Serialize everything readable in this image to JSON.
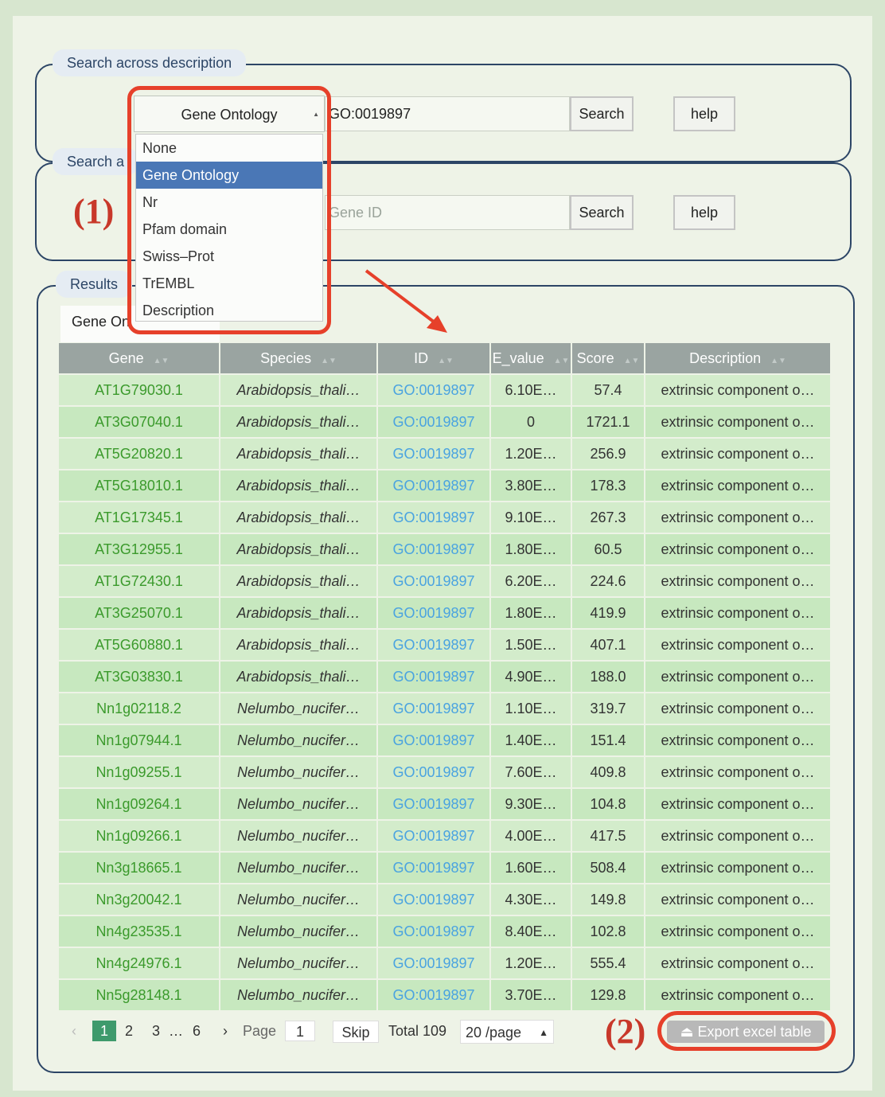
{
  "panels": {
    "description_search": {
      "legend": "Search across description",
      "input_value": "GO:0019897",
      "search_label": "Search",
      "help_label": "help"
    },
    "gene_search": {
      "legend": "Search a",
      "input_placeholder": "Gene ID",
      "search_label": "Search",
      "help_label": "help"
    },
    "results": {
      "legend": "Results",
      "tab_label": "Gene On"
    }
  },
  "dropdown": {
    "selected": "Gene Ontology",
    "options": [
      "None",
      "Gene Ontology",
      "Nr",
      "Pfam domain",
      "Swiss–Prot",
      "TrEMBL",
      "Description"
    ]
  },
  "annotations": {
    "one": "(1)",
    "two": "(2)"
  },
  "table": {
    "headers": [
      "Gene",
      "Species",
      "ID",
      "E_value",
      "Score",
      "Description"
    ],
    "rows": [
      [
        "AT1G79030.1",
        "Arabidopsis_thali…",
        "GO:0019897",
        "6.10E…",
        "57.4",
        "extrinsic component o…"
      ],
      [
        "AT3G07040.1",
        "Arabidopsis_thali…",
        "GO:0019897",
        "0",
        "1721.1",
        "extrinsic component o…"
      ],
      [
        "AT5G20820.1",
        "Arabidopsis_thali…",
        "GO:0019897",
        "1.20E…",
        "256.9",
        "extrinsic component o…"
      ],
      [
        "AT5G18010.1",
        "Arabidopsis_thali…",
        "GO:0019897",
        "3.80E…",
        "178.3",
        "extrinsic component o…"
      ],
      [
        "AT1G17345.1",
        "Arabidopsis_thali…",
        "GO:0019897",
        "9.10E…",
        "267.3",
        "extrinsic component o…"
      ],
      [
        "AT3G12955.1",
        "Arabidopsis_thali…",
        "GO:0019897",
        "1.80E…",
        "60.5",
        "extrinsic component o…"
      ],
      [
        "AT1G72430.1",
        "Arabidopsis_thali…",
        "GO:0019897",
        "6.20E…",
        "224.6",
        "extrinsic component o…"
      ],
      [
        "AT3G25070.1",
        "Arabidopsis_thali…",
        "GO:0019897",
        "1.80E…",
        "419.9",
        "extrinsic component o…"
      ],
      [
        "AT5G60880.1",
        "Arabidopsis_thali…",
        "GO:0019897",
        "1.50E…",
        "407.1",
        "extrinsic component o…"
      ],
      [
        "AT3G03830.1",
        "Arabidopsis_thali…",
        "GO:0019897",
        "4.90E…",
        "188.0",
        "extrinsic component o…"
      ],
      [
        "Nn1g02118.2",
        "Nelumbo_nucifer…",
        "GO:0019897",
        "1.10E…",
        "319.7",
        "extrinsic component o…"
      ],
      [
        "Nn1g07944.1",
        "Nelumbo_nucifer…",
        "GO:0019897",
        "1.40E…",
        "151.4",
        "extrinsic component o…"
      ],
      [
        "Nn1g09255.1",
        "Nelumbo_nucifer…",
        "GO:0019897",
        "7.60E…",
        "409.8",
        "extrinsic component o…"
      ],
      [
        "Nn1g09264.1",
        "Nelumbo_nucifer…",
        "GO:0019897",
        "9.30E…",
        "104.8",
        "extrinsic component o…"
      ],
      [
        "Nn1g09266.1",
        "Nelumbo_nucifer…",
        "GO:0019897",
        "4.00E…",
        "417.5",
        "extrinsic component o…"
      ],
      [
        "Nn3g18665.1",
        "Nelumbo_nucifer…",
        "GO:0019897",
        "1.60E…",
        "508.4",
        "extrinsic component o…"
      ],
      [
        "Nn3g20042.1",
        "Nelumbo_nucifer…",
        "GO:0019897",
        "4.30E…",
        "149.8",
        "extrinsic component o…"
      ],
      [
        "Nn4g23535.1",
        "Nelumbo_nucifer…",
        "GO:0019897",
        "8.40E…",
        "102.8",
        "extrinsic component o…"
      ],
      [
        "Nn4g24976.1",
        "Nelumbo_nucifer…",
        "GO:0019897",
        "1.20E…",
        "555.4",
        "extrinsic component o…"
      ],
      [
        "Nn5g28148.1",
        "Nelumbo_nucifer…",
        "GO:0019897",
        "3.70E…",
        "129.8",
        "extrinsic component o…"
      ]
    ]
  },
  "pagination": {
    "prev": "‹",
    "pages": [
      "1",
      "2",
      "3",
      "6"
    ],
    "ellipsis": "…",
    "next": "›",
    "page_label": "Page",
    "page_input": "1",
    "skip_label": "Skip",
    "total": "Total 109",
    "page_size": "20 /page"
  },
  "export": {
    "label": "Export excel table",
    "icon": "export-icon"
  },
  "colors": {
    "annotation": "#e6402a",
    "selected_option": "#4a77b6",
    "gene_link": "#3b9a2c",
    "go_link": "#4aa3e0",
    "active_page": "#3e9a6c"
  }
}
